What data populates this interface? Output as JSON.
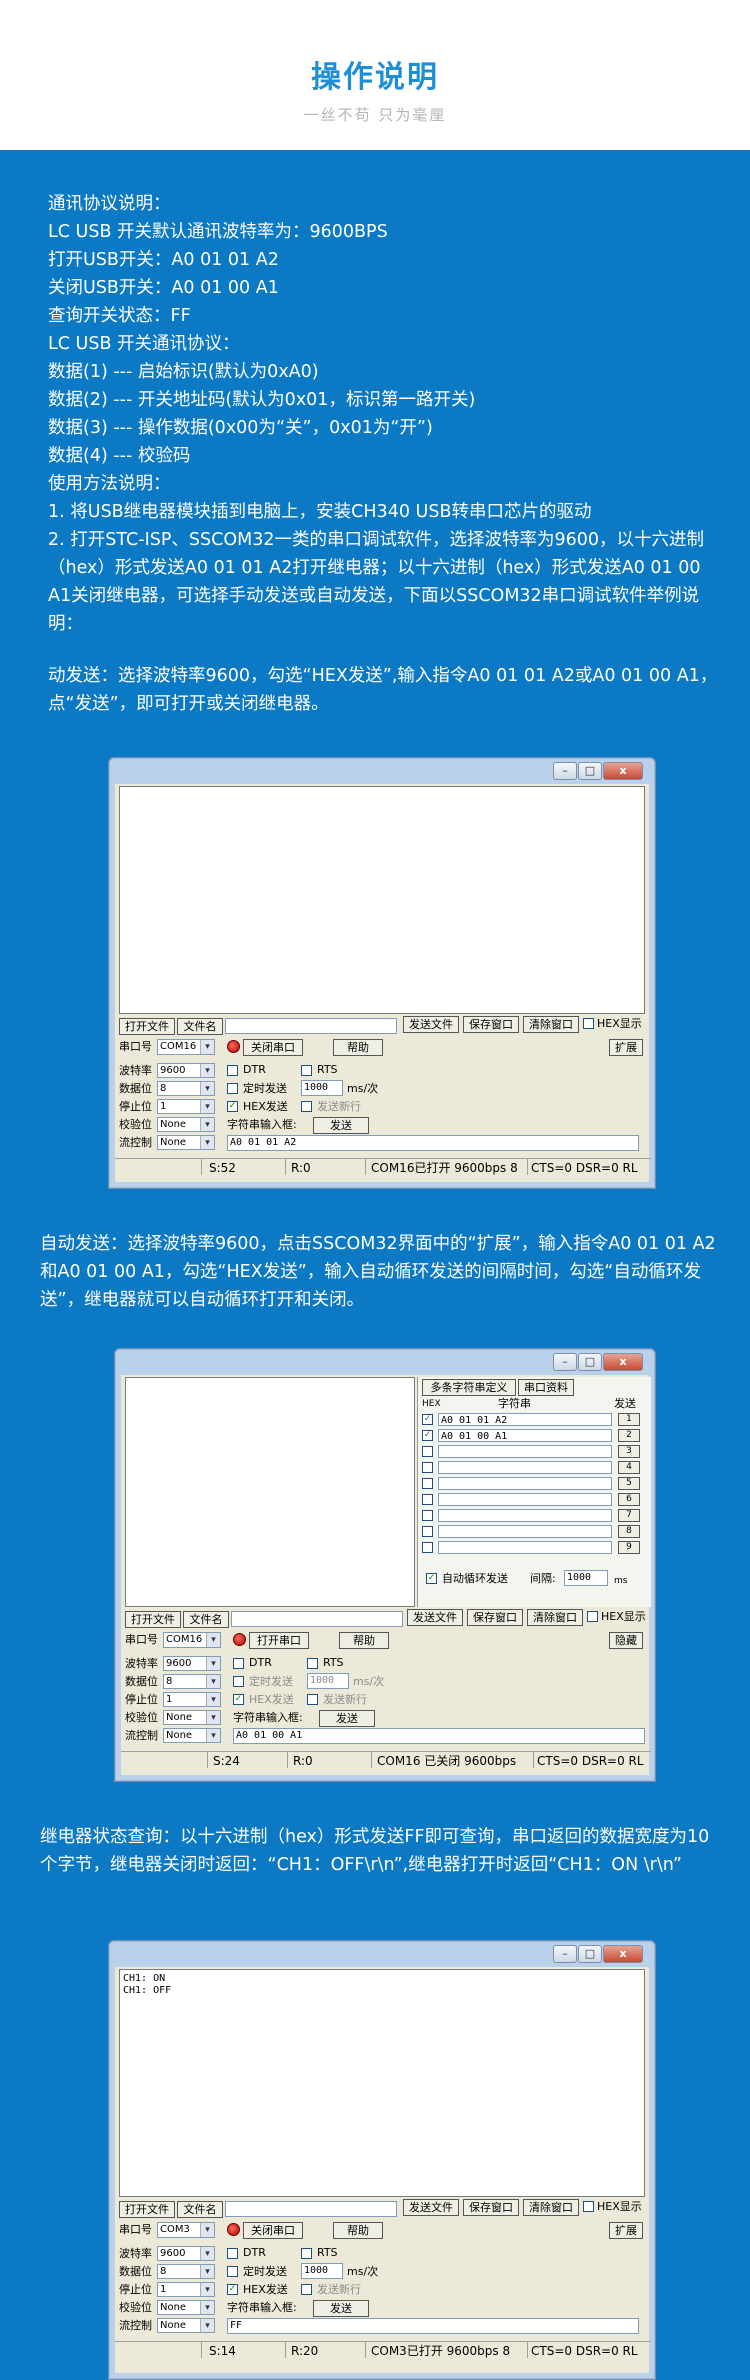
{
  "header": {
    "title": "操作说明",
    "subtitle": "一丝不苟 只为毫厘"
  },
  "intro_lines": [
    "通讯协议说明：",
    "LC USB 开关默认通讯波特率为：9600BPS",
    "打开USB开关：A0 01 01 A2",
    "关闭USB开关：A0 01 00 A1",
    "查询开关状态：FF",
    "LC USB 开关通讯协议：",
    "数据(1) --- 启始标识(默认为0xA0)",
    "数据(2) --- 开关地址码(默认为0x01，标识第一路开关)",
    "数据(3) --- 操作数据(0x00为“关”，0x01为“开”)",
    "数据(4) --- 校验码",
    "使用方法说明：",
    "1.    将USB继电器模块插到电脑上，安装CH340 USB转串口芯片的驱动"
  ],
  "step2": "2.    打开STC-ISP、SSCOM32一类的串口调试软件，选择波特率为9600，以十六进制（hex）形式发送A0 01 01 A2打开继电器；以十六进制（hex）形式发送A0 01 00 A1关闭继电器，可选择手动发送或自动发送，下面以SSCOM32串口调试软件举例说明：",
  "manual_send": "动发送：选择波特率9600，勾选“HEX发送”,输入指令A0 01 01 A2或A0 01 00 A1，点“发送”，即可打开或关闭继电器。",
  "auto_send": "自动发送：选择波特率9600，点击SSCOM32界面中的“扩展”，输入指令A0 01 01 A2和A0 01 00 A1，勾选“HEX发送”，输入自动循环发送的间隔时间，勾选“自动循环发送”，继电器就可以自动循环打开和关闭。",
  "query": "继电器状态查询：以十六进制（hex）形式发送FF即可查询，串口返回的数据宽度为10个字节，继电器关闭时返回：“CH1：OFF\\r\\n”,继电器打开时返回“CH1：ON \\r\\n”",
  "sscom": {
    "open_file": "打开文件",
    "file_name": "文件名",
    "send_file": "发送文件",
    "save_window": "保存窗口",
    "clear_window": "清除窗口",
    "hex_display": "HEX显示",
    "port_label": "串口号",
    "close_port": "关闭串口",
    "open_port": "打开串口",
    "help": "帮助",
    "expand": "扩展",
    "hide": "隐藏",
    "baud_label": "波特率",
    "data_label": "数据位",
    "stop_label": "停止位",
    "parity_label": "校验位",
    "flow_label": "流控制",
    "baud": "9600",
    "databits": "8",
    "stopbits": "1",
    "parity": "None",
    "flow": "None",
    "dtr": "DTR",
    "rts": "RTS",
    "timed_send": "定时发送",
    "interval": "1000",
    "ms_per": "ms/次",
    "hex_send": "HEX发送",
    "send_newline": "发送新行",
    "input_label": "字符串输入框:",
    "send": "发送"
  },
  "win1": {
    "port": "COM16",
    "input": "A0 01 01 A2",
    "status_s": "S:52",
    "status_r": "R:0",
    "status_port": "COM16已打开  9600bps  8",
    "status_lines": "CTS=0 DSR=0 RL"
  },
  "win2": {
    "port": "COM16",
    "input": "A0 01 00 A1",
    "status_s": "S:24",
    "status_r": "R:0",
    "status_port": "COM16 已关闭  9600bps",
    "status_lines": "CTS=0 DSR=0 RL",
    "multi_tab": "多条字符串定义",
    "serial_tab": "串口资料",
    "col_hex": "HEX",
    "col_str": "字符串",
    "col_send": "发送",
    "rows": [
      {
        "str": "A0 01 01 A2",
        "n": "1"
      },
      {
        "str": "A0 01 00 A1",
        "n": "2"
      },
      {
        "str": "",
        "n": "3"
      },
      {
        "str": "",
        "n": "4"
      },
      {
        "str": "",
        "n": "5"
      },
      {
        "str": "",
        "n": "6"
      },
      {
        "str": "",
        "n": "7"
      },
      {
        "str": "",
        "n": "8"
      },
      {
        "str": "",
        "n": "9"
      }
    ],
    "auto_loop": "自动循环发送",
    "interval_label": "间隔:",
    "interval": "1000",
    "ms": "ms"
  },
  "win3": {
    "port": "COM3",
    "input": "FF",
    "recv_line1": "CH1: ON",
    "recv_line2": "CH1: OFF",
    "status_s": "S:14",
    "status_r": "R:20",
    "status_port": "COM3已打开  9600bps  8",
    "status_lines": "CTS=0 DSR=0 RL"
  },
  "colors": {
    "blue_bg": "#0c79c4",
    "title_blue": "#1e8fd4"
  }
}
